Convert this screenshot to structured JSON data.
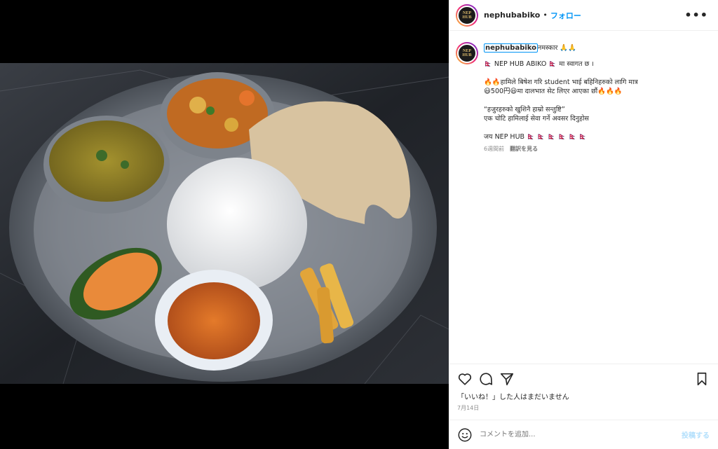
{
  "post": {
    "username": "nephubabiko",
    "separator": "•",
    "follow_label": "フォロー",
    "more_label": "•••",
    "avatar_text_top": "NEP",
    "avatar_text_bottom": "HUB"
  },
  "caption": {
    "username": "nephubabiko",
    "greeting": "नमस्कार 🙏🙏",
    "lines": [
      "🇳🇵 NEP HUB ABIKO 🇳🇵 मा स्वागत छ ।",
      "",
      "🔥🔥हामिले बिषेश गरि student भाई बहिनिहरुको लागि मात्र",
      "😃500円😃मा दालभात सेट लिएर आएका छौं🔥🔥🔥",
      "",
      "“हजुरहरुको खुशिनै हाम्रो सन्तुष्टि”",
      "एक चोटि हामिलाई सेवा गर्ने अवसर दिनुहोस",
      "",
      "जय NEP HUB 🇳🇵 🇳🇵 🇳🇵 🇳🇵 🇳🇵 🇳🇵"
    ],
    "time_ago": "6週間前",
    "translate_label": "翻訳を見る"
  },
  "actions": {
    "likes_text": "「いいね！」した人はまだいません",
    "date": "7月14日"
  },
  "comment": {
    "placeholder": "コメントを追加...",
    "post_label": "投稿する"
  }
}
